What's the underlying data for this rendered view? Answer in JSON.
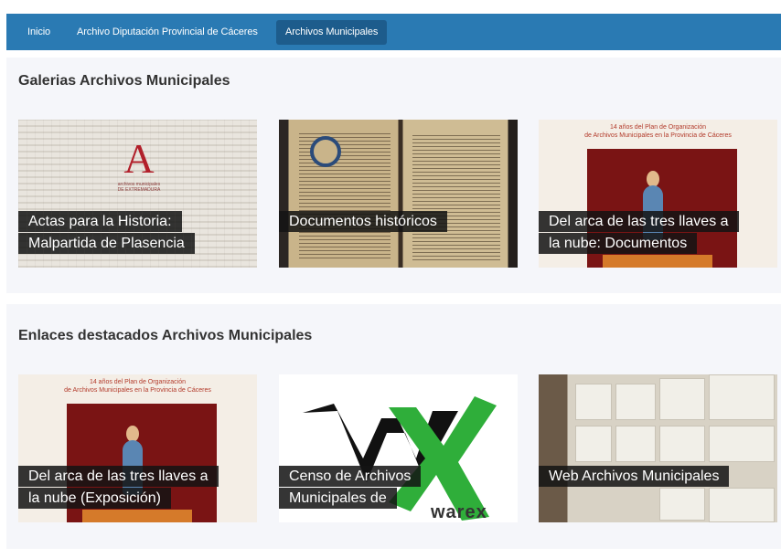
{
  "nav": {
    "items": [
      {
        "label": "Inicio"
      },
      {
        "label": "Archivo Diputación Provincial de Cáceres"
      },
      {
        "label": "Archivos Municipales",
        "active": true
      }
    ],
    "bar_color": "#2a7ab3",
    "active_color": "#1d5c8c"
  },
  "galerias": {
    "title": "Galerias Archivos Municipales",
    "cards": [
      {
        "line1": "Actas para la Historia:",
        "line2": "Malpartida de Plasencia",
        "logo_mark": "A",
        "logo_text1": "archivos municipales",
        "logo_text2": "DE EXTREMADURA"
      },
      {
        "line1": "Documentos históricos"
      },
      {
        "line1": "Del arca de las tres llaves a",
        "line2": "la nube: Documentos",
        "poster_line1": "14 años del Plan de Organización",
        "poster_line2": "de Archivos Municipales en la Provincia de Cáceres"
      }
    ]
  },
  "enlaces": {
    "title": "Enlaces destacados Archivos Municipales",
    "cards": [
      {
        "line1": "Del arca de las tres llaves a",
        "line2": "la nube (Exposición)",
        "poster_line1": "14 años del Plan de Organización",
        "poster_line2": "de Archivos Municipales en la Provincia de Cáceres"
      },
      {
        "line1": "Censo de Archivos",
        "line2": "Municipales de",
        "logo_text": "warex"
      },
      {
        "line1": "Web Archivos Municipales"
      }
    ]
  },
  "colors": {
    "section_bg": "#f5f6fa",
    "warex_green": "#2fae3a",
    "poster_red": "#7a1414"
  }
}
